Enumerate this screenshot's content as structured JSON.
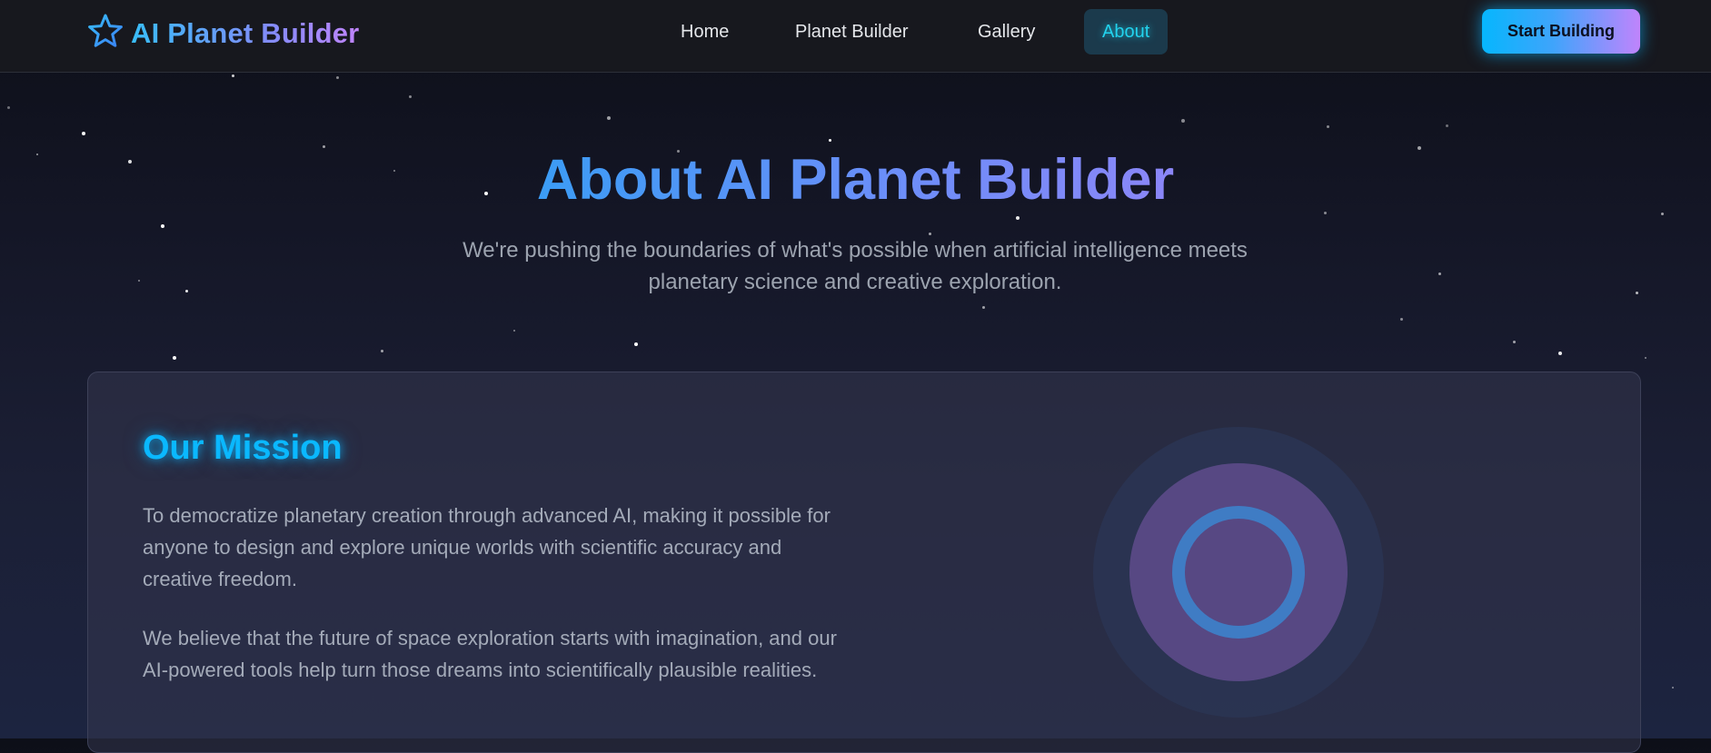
{
  "brand": {
    "name": "AI Planet Builder",
    "icon": "star-icon"
  },
  "nav": {
    "links": [
      {
        "label": "Home",
        "active": false
      },
      {
        "label": "Planet Builder",
        "active": false
      },
      {
        "label": "Gallery",
        "active": false
      },
      {
        "label": "About",
        "active": true
      }
    ],
    "cta_label": "Start Building"
  },
  "hero": {
    "title": "About AI Planet Builder",
    "subtitle": "We're pushing the boundaries of what's possible when artificial intelligence meets planetary science and creative exploration."
  },
  "mission": {
    "title": "Our Mission",
    "paragraphs": [
      "To democratize planetary creation through advanced AI, making it possible for anyone to design and explore unique worlds with scientific accuracy and creative freedom.",
      "We believe that the future of space exploration starts with imagination, and our AI-powered tools help turn those dreams into scientifically plausible realities."
    ],
    "illustration": "planet-rings-icon"
  },
  "colors": {
    "accent_cyan": "#22d3ee",
    "brand_blue": "#38bdf8",
    "brand_purple": "#c084fc",
    "background": "#141626"
  }
}
